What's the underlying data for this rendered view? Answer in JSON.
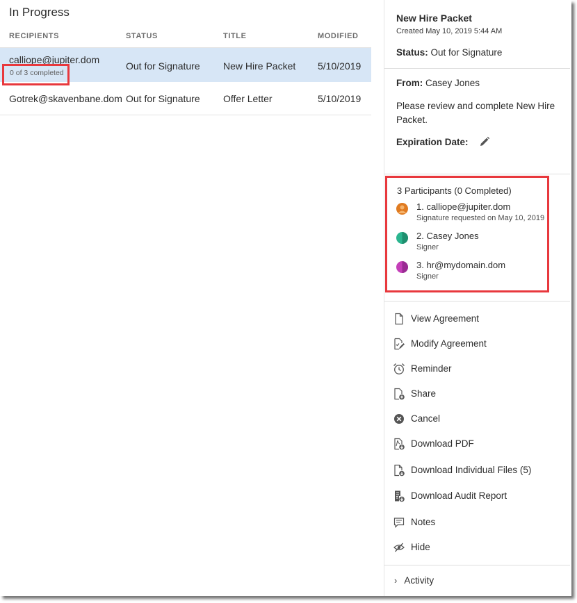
{
  "list": {
    "title": "In Progress",
    "columns": {
      "recipients": "RECIPIENTS",
      "status": "STATUS",
      "title": "TITLE",
      "modified": "MODIFIED"
    },
    "rows": [
      {
        "recipient": "calliope@jupiter.dom",
        "progress": "0 of 3 completed",
        "status": "Out for Signature",
        "title": "New Hire Packet",
        "modified": "5/10/2019",
        "selected": true
      },
      {
        "recipient": "Gotrek@skavenbane.dom",
        "status": "Out for Signature",
        "title": "Offer Letter",
        "modified": "5/10/2019",
        "selected": false
      }
    ]
  },
  "details": {
    "title": "New Hire Packet",
    "created": "Created May 10, 2019 5:44 AM",
    "status_label": "Status:",
    "status_value": "Out for Signature",
    "from_label": "From:",
    "from_value": "Casey Jones",
    "message": "Please review and complete New Hire Packet.",
    "expiration_label": "Expiration Date:",
    "participants_heading": "3 Participants (0 Completed)",
    "participants": [
      {
        "name": "1. calliope@jupiter.dom",
        "role": "Signature requested on May 10, 2019",
        "color": "#e07b21"
      },
      {
        "name": "2. Casey Jones",
        "role": "Signer",
        "color": "#2bb58f"
      },
      {
        "name": "3. hr@mydomain.dom",
        "role": "Signer",
        "color": "#c43fb8"
      }
    ],
    "actions": [
      {
        "label": "View Agreement",
        "icon": "document-icon"
      },
      {
        "label": "Modify Agreement",
        "icon": "document-edit-icon"
      },
      {
        "label": "Reminder",
        "icon": "alarm-clock-icon"
      },
      {
        "label": "Share",
        "icon": "share-document-icon"
      },
      {
        "label": "Cancel",
        "icon": "cancel-circle-icon"
      },
      {
        "label": "Download PDF",
        "icon": "download-pdf-icon"
      },
      {
        "label": "Download Individual Files (5)",
        "icon": "download-files-icon"
      },
      {
        "label": "Download Audit Report",
        "icon": "audit-report-icon"
      },
      {
        "label": "Notes",
        "icon": "notes-icon"
      },
      {
        "label": "Hide",
        "icon": "hide-eye-icon"
      }
    ],
    "activity": "Activity"
  },
  "colors": {
    "selected_row": "#d7e6f6",
    "highlight": "#e8383d",
    "divider": "#dedede"
  }
}
